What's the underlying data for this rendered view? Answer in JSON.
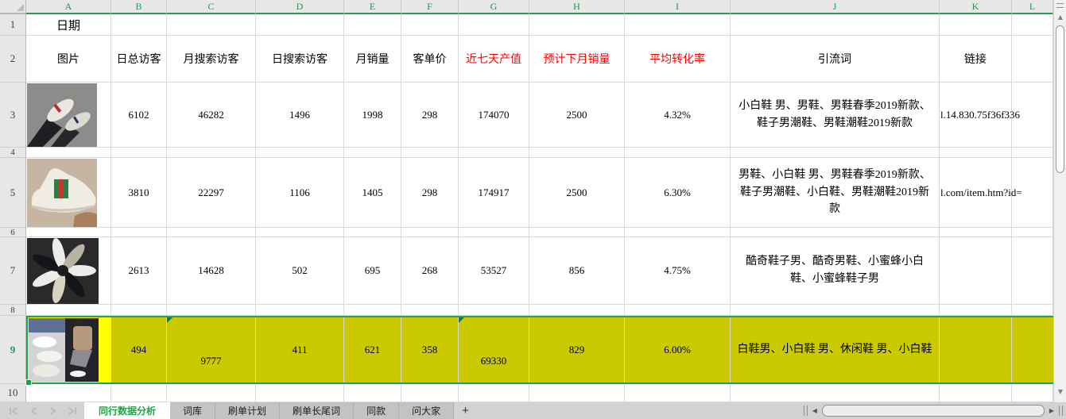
{
  "grid": {
    "column_letters": [
      "A",
      "B",
      "C",
      "D",
      "E",
      "F",
      "G",
      "H",
      "I",
      "J",
      "K",
      "L"
    ],
    "row_numbers": [
      "1",
      "2",
      "3",
      "4",
      "5",
      "6",
      "7",
      "8",
      "9",
      "10"
    ],
    "date_label": "日期",
    "headers": {
      "image": "图片",
      "daily_total_visitors": "日总访客",
      "monthly_search_visitors": "月搜索访客",
      "daily_search_visitors": "日搜索访客",
      "monthly_sales": "月销量",
      "unit_price": "客单价",
      "seven_day_output": "近七天产值",
      "next_month_forecast": "预计下月销量",
      "avg_conversion_rate": "平均转化率",
      "traffic_keywords": "引流词",
      "link": "链接"
    },
    "products": [
      {
        "row": "3",
        "daily_total_visitors": "6102",
        "monthly_search_visitors": "46282",
        "daily_search_visitors": "1496",
        "monthly_sales": "1998",
        "unit_price": "298",
        "seven_day_output": "174070",
        "next_month_forecast": "2500",
        "avg_conversion_rate": "4.32%",
        "traffic_keywords": "小白鞋 男、男鞋、男鞋春季2019新款、鞋子男潮鞋、男鞋潮鞋2019新款",
        "link": "l.14.830.75f36f336"
      },
      {
        "row": "5",
        "daily_total_visitors": "3810",
        "monthly_search_visitors": "22297",
        "daily_search_visitors": "1106",
        "monthly_sales": "1405",
        "unit_price": "298",
        "seven_day_output": "174917",
        "next_month_forecast": "2500",
        "avg_conversion_rate": "6.30%",
        "traffic_keywords": "男鞋、小白鞋 男、男鞋春季2019新款、鞋子男潮鞋、小白鞋、男鞋潮鞋2019新款",
        "link": "l.com/item.htm?id="
      },
      {
        "row": "7",
        "daily_total_visitors": "2613",
        "monthly_search_visitors": "14628",
        "daily_search_visitors": "502",
        "monthly_sales": "695",
        "unit_price": "268",
        "seven_day_output": "53527",
        "next_month_forecast": "856",
        "avg_conversion_rate": "4.75%",
        "traffic_keywords": "酷奇鞋子男、酷奇男鞋、小蜜蜂小白鞋、小蜜蜂鞋子男",
        "link": ""
      },
      {
        "row": "9",
        "daily_total_visitors": "494",
        "monthly_search_visitors": "9777",
        "daily_search_visitors": "411",
        "monthly_sales": "621",
        "unit_price": "358",
        "seven_day_output": "69330",
        "next_month_forecast": "829",
        "avg_conversion_rate": "6.00%",
        "traffic_keywords": "白鞋男、小白鞋 男、休闲鞋 男、小白鞋",
        "link": "",
        "highlighted": true
      }
    ]
  },
  "colors": {
    "header_text_red": "#ff0000",
    "selection_green": "#23a24c",
    "active_cell_yellow": "#ffff00",
    "selected_fill_olive": "#cbca00",
    "active_tab_green": "#21a346"
  },
  "sheet_tabs": {
    "active": "同行数据分析",
    "items": [
      "词库",
      "刷单计划",
      "刷单长尾词",
      "同款",
      "问大家"
    ],
    "add_label": "+"
  },
  "icons": {
    "scroll_up": "▲",
    "scroll_down": "▼",
    "scroll_left": "◀",
    "scroll_right": "▶"
  }
}
